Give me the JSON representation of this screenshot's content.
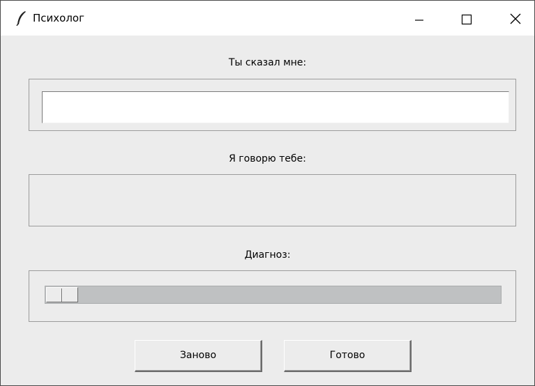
{
  "window": {
    "title": "Психолог",
    "icon": "feather-icon",
    "controls": [
      "minimize-icon",
      "maximize-icon",
      "close-icon"
    ]
  },
  "input_section": {
    "label": "Ты сказал мне:",
    "value": "",
    "placeholder": ""
  },
  "reply_section": {
    "label": "Я говорю тебе:",
    "text": ""
  },
  "diagnosis_section": {
    "label": "Диагноз:",
    "slider_value": 0
  },
  "buttons": {
    "restart_label": "Заново",
    "done_label": "Готово"
  }
}
